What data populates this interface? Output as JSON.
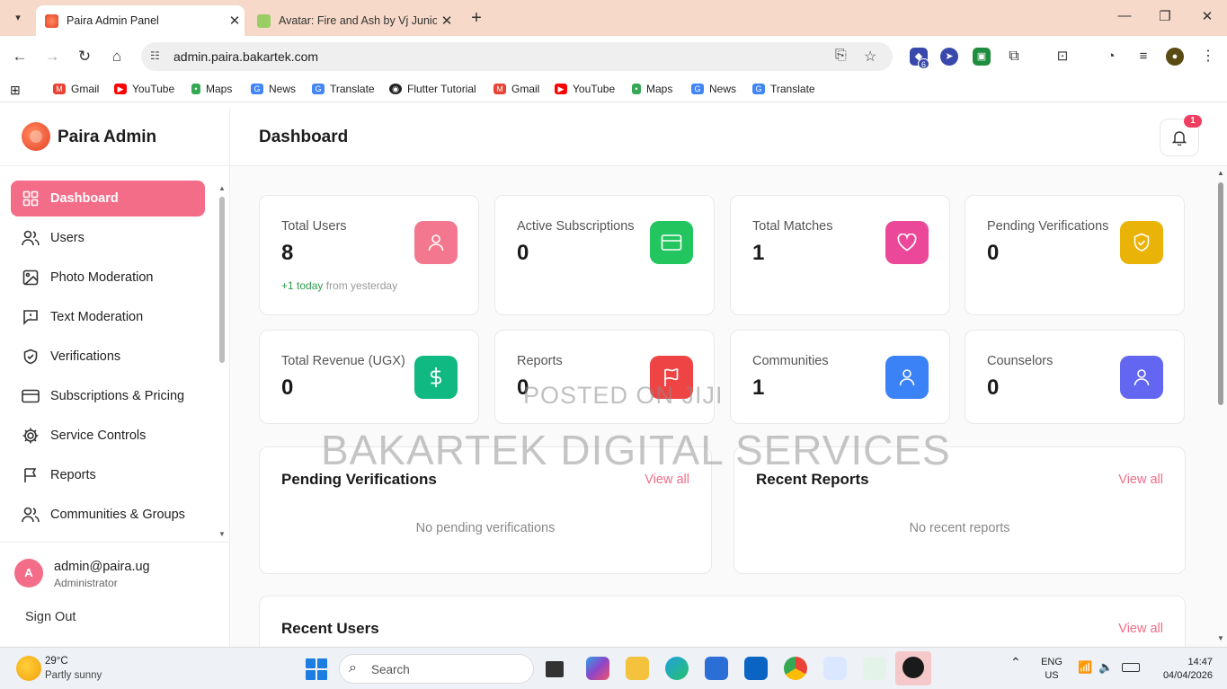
{
  "browser": {
    "tabs": [
      {
        "title": "Paira Admin Panel",
        "active": true
      },
      {
        "title": "Avatar: Fire and Ash by Vj Junio",
        "active": false
      }
    ],
    "url": "admin.paira.bakartek.com",
    "extension_badge": "6",
    "bookmarks": [
      "Gmail",
      "YouTube",
      "Maps",
      "News",
      "Translate",
      "Flutter Tutorial",
      "Gmail",
      "YouTube",
      "Maps",
      "News",
      "Translate"
    ]
  },
  "sidebar": {
    "brand": "Paira Admin",
    "items": [
      {
        "label": "Dashboard"
      },
      {
        "label": "Users"
      },
      {
        "label": "Photo Moderation"
      },
      {
        "label": "Text Moderation"
      },
      {
        "label": "Verifications"
      },
      {
        "label": "Subscriptions & Pricing"
      },
      {
        "label": "Service Controls"
      },
      {
        "label": "Reports"
      },
      {
        "label": "Communities & Groups"
      }
    ],
    "user": {
      "initial": "A",
      "email": "admin@paira.ug",
      "role": "Administrator"
    },
    "sign_out": "Sign Out"
  },
  "header": {
    "title": "Dashboard",
    "notification_count": "1"
  },
  "stats": [
    {
      "label": "Total Users",
      "value": "8",
      "sub_pos": "+1 today",
      "sub_rest": " from yesterday",
      "color": "#f3788f",
      "icon": "user-icon"
    },
    {
      "label": "Active Subscriptions",
      "value": "0",
      "color": "#22c55e",
      "icon": "credit-card-icon"
    },
    {
      "label": "Total Matches",
      "value": "1",
      "color": "#ec4899",
      "icon": "heart-icon"
    },
    {
      "label": "Pending Verifications",
      "value": "0",
      "color": "#eab308",
      "icon": "shield-check-icon"
    },
    {
      "label": "Total Revenue (UGX)",
      "value": "0",
      "color": "#10b981",
      "icon": "dollar-icon"
    },
    {
      "label": "Reports",
      "value": "0",
      "color": "#ef4444",
      "icon": "flag-icon"
    },
    {
      "label": "Communities",
      "value": "1",
      "color": "#3b82f6",
      "icon": "user-icon"
    },
    {
      "label": "Counselors",
      "value": "0",
      "color": "#6366f1",
      "icon": "user-icon"
    }
  ],
  "panels": {
    "pending": {
      "title": "Pending Verifications",
      "link": "View all",
      "empty": "No pending verifications"
    },
    "reports": {
      "title": "Recent Reports",
      "link": "View all",
      "empty": "No recent reports"
    },
    "users": {
      "title": "Recent Users",
      "link": "View all"
    }
  },
  "watermark": {
    "line1": "POSTED ON JIJI",
    "line2": "BAKARTEK DIGITAL SERVICES"
  },
  "taskbar": {
    "temp": "29°C",
    "weather": "Partly sunny",
    "search": "Search",
    "lang1": "ENG",
    "lang2": "US",
    "time": "14:47",
    "date": "04/04/2026"
  }
}
